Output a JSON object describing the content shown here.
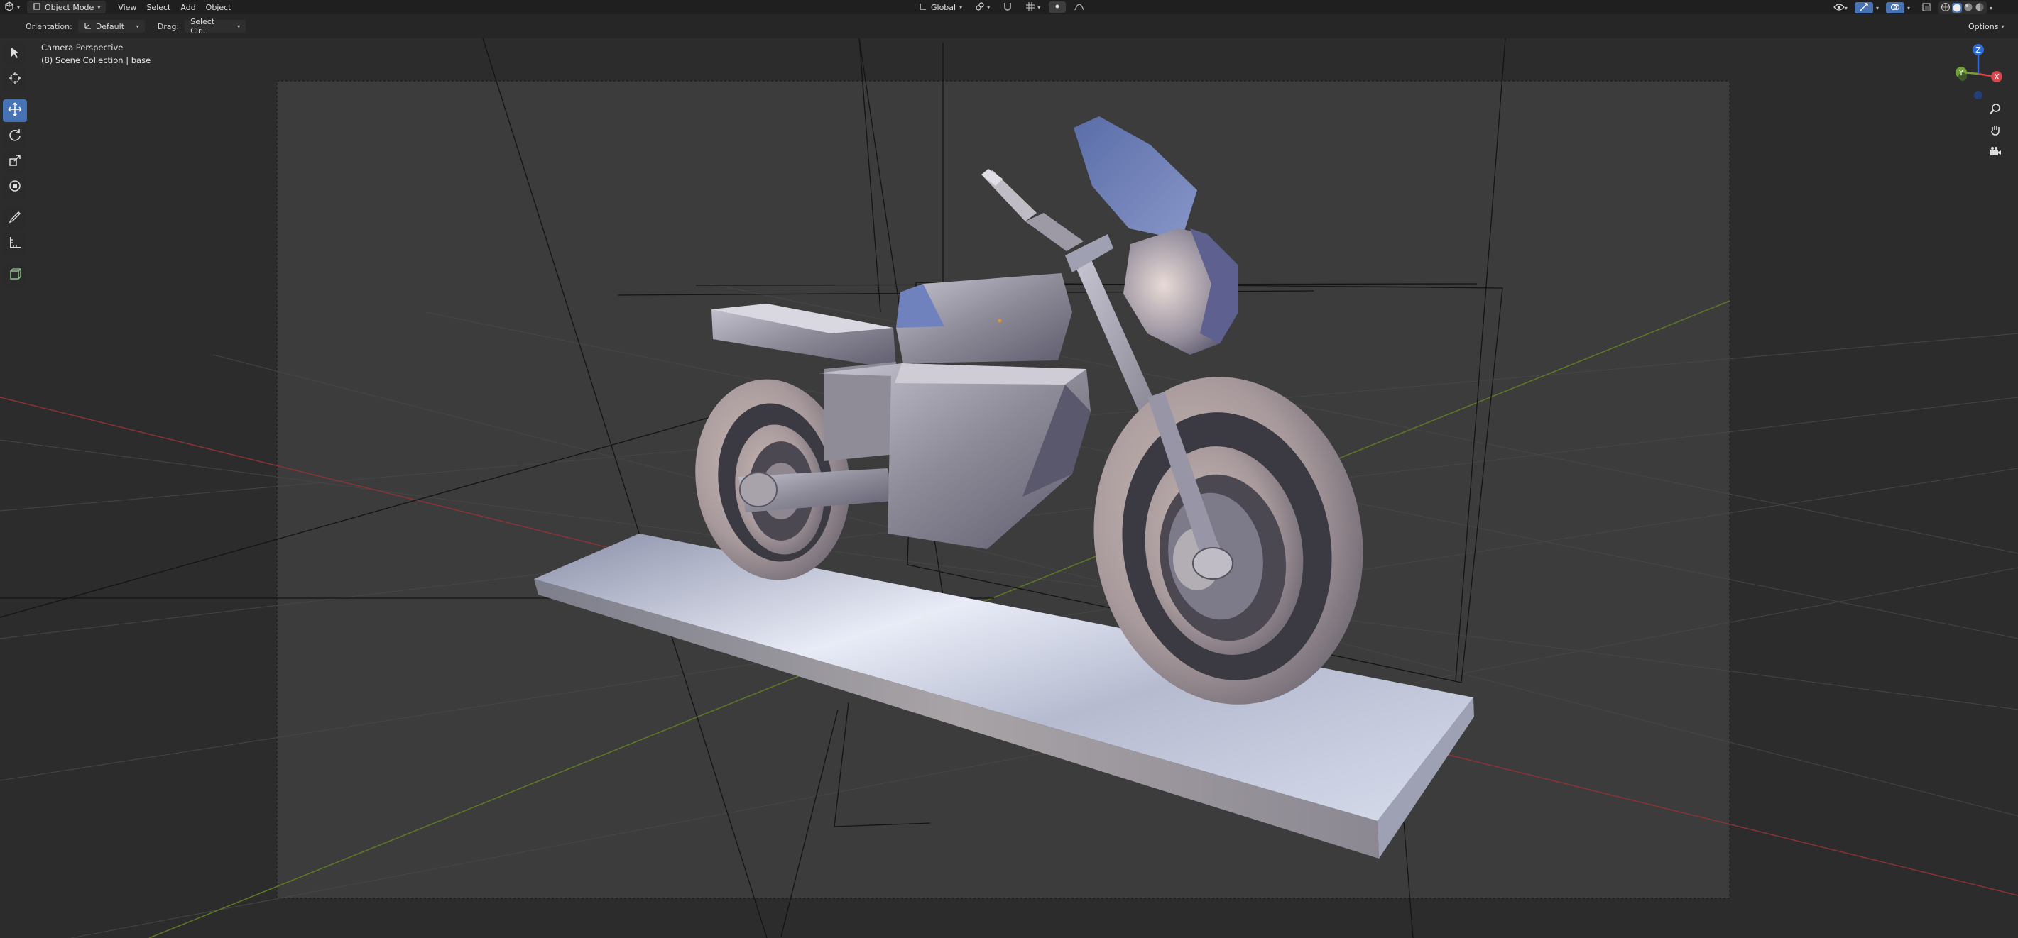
{
  "header": {
    "editor_type_icon": "cube-editor-icon",
    "mode": "Object Mode",
    "menus": [
      "View",
      "Select",
      "Add",
      "Object"
    ],
    "transform_space": "Global",
    "options_label": "Options"
  },
  "tool_settings": {
    "orientation_label": "Orientation:",
    "orientation_value": "Default",
    "drag_label": "Drag:",
    "drag_value": "Select Cir..."
  },
  "viewport": {
    "view_name": "Camera Perspective",
    "collection_info": "(8) Scene Collection | base"
  },
  "toolbar": {
    "tools": [
      {
        "name": "select-box-icon",
        "active": false
      },
      {
        "name": "cursor-icon",
        "active": false
      },
      {
        "name": "move-icon",
        "active": true
      },
      {
        "name": "rotate-icon",
        "active": false
      },
      {
        "name": "scale-icon",
        "active": false
      },
      {
        "name": "transform-icon",
        "active": false
      },
      {
        "name": "annotate-icon",
        "active": false
      },
      {
        "name": "measure-icon",
        "active": false
      },
      {
        "name": "add-cube-icon",
        "active": false
      }
    ]
  },
  "gizmo": {
    "axes": [
      {
        "label": "Z",
        "color": "#2f6bd6"
      },
      {
        "label": "X",
        "color": "#d8474f"
      },
      {
        "label": "Y",
        "color": "#71a035"
      }
    ]
  },
  "colors": {
    "header_bg": "#1f1f1f",
    "viewport_bg": "#3a3a3a",
    "accent": "#4772b3",
    "x_axis": "#a83a3a",
    "y_axis": "#6a8a2a"
  }
}
